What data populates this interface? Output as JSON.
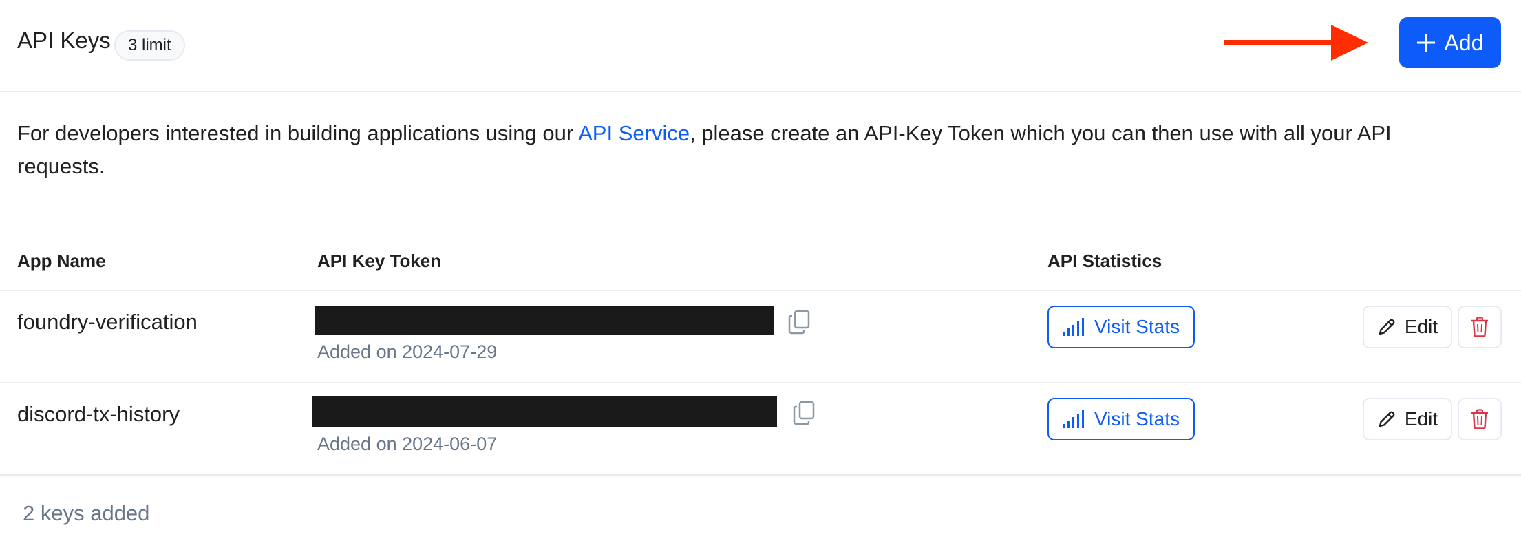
{
  "header": {
    "title": "API Keys",
    "limit_badge": "3 limit",
    "add_label": "Add"
  },
  "description": {
    "before": "For developers interested in building applications using our ",
    "link": "API Service",
    "after": ", please create an API-Key Token which you can then use with all your API requests."
  },
  "table": {
    "columns": [
      "App Name",
      "API Key Token",
      "API Statistics"
    ],
    "rows": [
      {
        "app_name": "foundry-verification",
        "added": "Added on 2024-07-29",
        "stats_label": "Visit Stats",
        "edit_label": "Edit"
      },
      {
        "app_name": "discord-tx-history",
        "added": "Added on 2024-06-07",
        "stats_label": "Visit Stats",
        "edit_label": "Edit"
      }
    ]
  },
  "footer": {
    "count_text": "2 keys added"
  },
  "icons": {
    "add": "plus-icon",
    "copy": "copy-icon",
    "stats": "signal-bars-icon",
    "edit": "pencil-icon",
    "delete": "trash-icon",
    "annotation": "arrow-right-icon"
  },
  "colors": {
    "accent": "#0d5cfa",
    "danger": "#dc3545",
    "arrow": "#ff2d00",
    "muted": "#677788"
  }
}
